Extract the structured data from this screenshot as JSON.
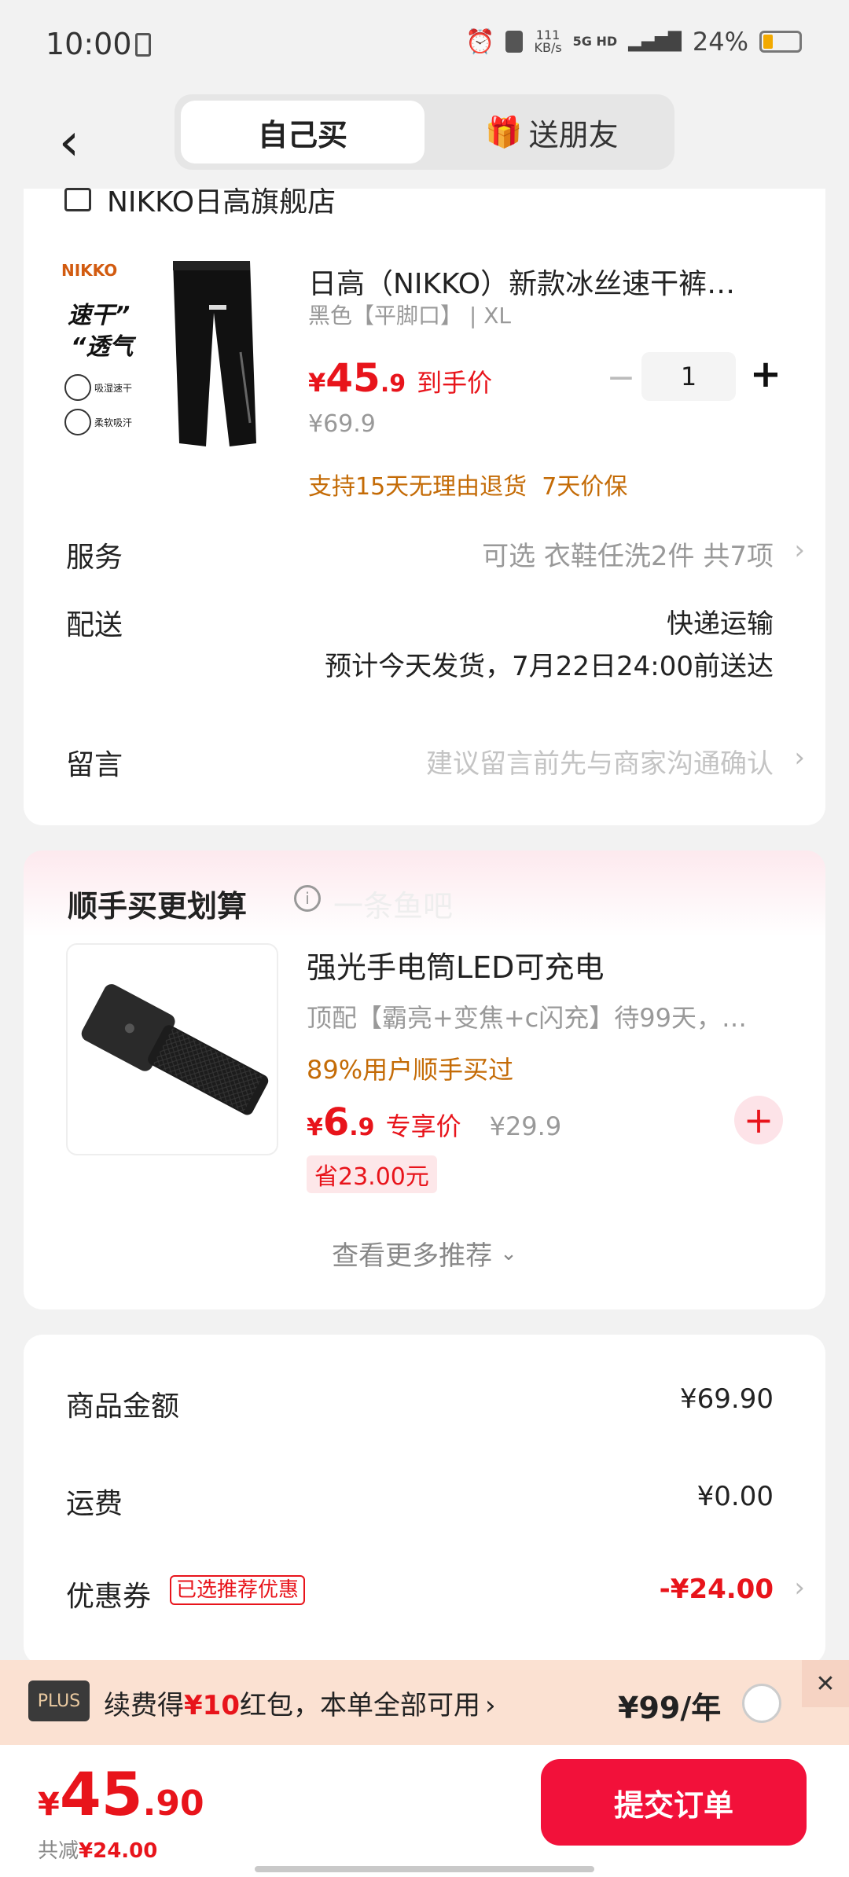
{
  "status": {
    "time": "10:00",
    "net_speed_top": "111",
    "net_speed_bottom": "KB/s",
    "network": "5G HD",
    "battery": "24%",
    "battery_level": 0.24
  },
  "header": {
    "tab_self": "自己买",
    "tab_gift": "送朋友",
    "gift_emoji": "🎁"
  },
  "store": {
    "name": "NIKKO日高旗舰店"
  },
  "product": {
    "thumb_brand": "NIKKO",
    "thumb_line1": "速干”",
    "thumb_line2": "“透气",
    "thumb_badge1": "吸湿速干",
    "thumb_badge2": "柔软吸汗",
    "title": "日高（NIKKO）新款冰丝速干裤…",
    "variant": "黑色【平脚口】 | XL",
    "price_symbol": "¥",
    "price_int": "45",
    "price_dec": ".9",
    "price_label": "到手价",
    "original_price": "¥69.9",
    "quantity": "1",
    "minus": "−",
    "plus": "+",
    "guarantee": "支持15天无理由退货  7天价保"
  },
  "service": {
    "label": "服务",
    "value": "可选 衣鞋任洗2件 共7项"
  },
  "delivery": {
    "label": "配送",
    "method": "快递运输",
    "eta": "预计今天发货，7月22日24:00前送达"
  },
  "note": {
    "label": "留言",
    "placeholder": "建议留言前先与商家沟通确认"
  },
  "upsell": {
    "title": "顺手买更划算",
    "info": "i",
    "ghost_text": "一条鱼吧",
    "item_title": "强光手电筒LED可充电",
    "item_desc": "顶配【霸亮+变焦+c闪充】待99天，…",
    "bought": "89%用户顺手买过",
    "price_symbol": "¥",
    "price_int": "6",
    "price_dec": ".9",
    "price_label": "专享价",
    "original": "¥29.9",
    "save": "省23.00元",
    "add": "+",
    "more": "查看更多推荐"
  },
  "summary": {
    "goods_label": "商品金额",
    "goods_value": "¥69.90",
    "shipping_label": "运费",
    "shipping_value": "¥0.00",
    "coupon_label": "优惠券",
    "coupon_tag": "已选推荐优惠",
    "coupon_value": "-¥24.00"
  },
  "plus_bar": {
    "badge": "PLUS",
    "text_pre": "续费得",
    "text_amount": "¥10",
    "text_post": "红包，本单全部可用",
    "price": "¥99/年",
    "close": "✕"
  },
  "bottom": {
    "symbol": "¥",
    "total_int": "45",
    "total_dec": ".90",
    "discount_label": "共减",
    "discount_value": "¥24.00",
    "submit": "提交订单"
  },
  "colors": {
    "accent": "#e8141b",
    "submit": "#f2113a",
    "orange": "#c46b06"
  }
}
